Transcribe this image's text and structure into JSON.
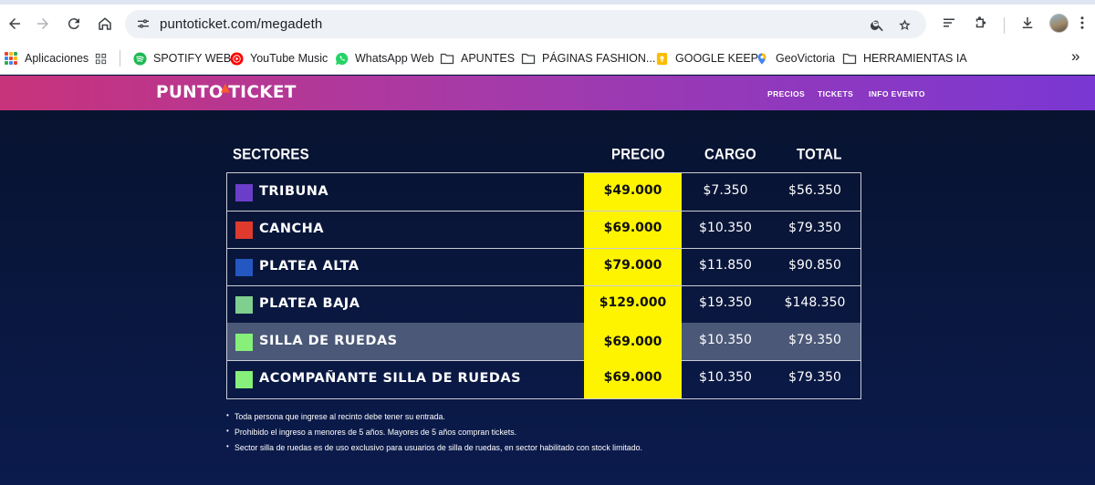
{
  "browser": {
    "url": "puntoticket.com/megadeth",
    "bookmarks": [
      {
        "label": "Aplicaciones",
        "icon": "apps-grid-icon"
      },
      {
        "label": "",
        "icon": "tab-groups-icon"
      },
      {
        "label": "SPOTIFY WEB",
        "icon": "spotify-icon"
      },
      {
        "label": "YouTube Music",
        "icon": "youtube-music-icon"
      },
      {
        "label": "WhatsApp Web",
        "icon": "whatsapp-icon"
      },
      {
        "label": "APUNTES",
        "icon": "folder-icon"
      },
      {
        "label": "PÁGINAS FASHION...",
        "icon": "folder-icon"
      },
      {
        "label": "GOOGLE KEEP",
        "icon": "google-keep-icon"
      },
      {
        "label": "GeoVictoria",
        "icon": "geovictoria-icon"
      },
      {
        "label": "HERRAMIENTAS IA",
        "icon": "folder-icon"
      }
    ],
    "overflow_label": "»"
  },
  "site": {
    "logo_text": "PUNTOTICKET",
    "logo_part1": "PUNT",
    "logo_part2": "O",
    "logo_part3": "TICKET",
    "nav": [
      "PRECIOS",
      "TICKETS",
      "INFO EVENTO"
    ]
  },
  "table": {
    "headers": {
      "sector": "SECTORES",
      "price": "PRECIO",
      "charge": "CARGO",
      "total": "TOTAL"
    },
    "rows": [
      {
        "sector": "TRIBUNA",
        "color": "#6b3ec9",
        "price": "$49.000",
        "charge": "$7.350",
        "total": "$56.350"
      },
      {
        "sector": "CANCHA",
        "color": "#e03a2f",
        "price": "$69.000",
        "charge": "$10.350",
        "total": "$79.350"
      },
      {
        "sector": "PLATEA ALTA",
        "color": "#2457c2",
        "price": "$79.000",
        "charge": "$11.850",
        "total": "$90.850"
      },
      {
        "sector": "PLATEA BAJA",
        "color": "#7fd08f",
        "price": "$129.000",
        "charge": "$19.350",
        "total": "$148.350"
      },
      {
        "sector": "SILLA DE RUEDAS",
        "color": "#86f07a",
        "price": "$69.000",
        "charge": "$10.350",
        "total": "$79.350",
        "highlighted": true
      },
      {
        "sector": "ACOMPAÑANTE SILLA DE RUEDAS",
        "color": "#86f07a",
        "price": "$69.000",
        "charge": "$10.350",
        "total": "$79.350"
      }
    ]
  },
  "notes": [
    "Toda persona que ingrese al recinto debe tener su entrada.",
    "Prohibido el ingreso a menores de 5 años. Mayores de 5 años compran tickets.",
    "Sector silla de ruedas es de uso exclusivo para usuarios de silla de ruedas, en sector habilitado con stock limitado."
  ]
}
